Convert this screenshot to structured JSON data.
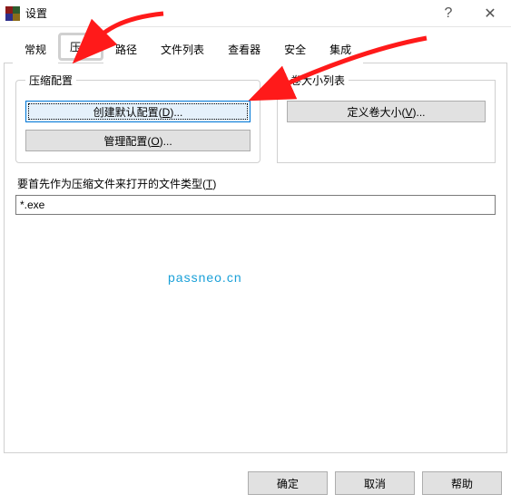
{
  "window": {
    "title": "设置"
  },
  "tabs": {
    "general": "常规",
    "compress": "压缩",
    "path": "路径",
    "filelist": "文件列表",
    "viewer": "查看器",
    "security": "安全",
    "integration": "集成"
  },
  "groups": {
    "compress_profile": {
      "legend": "压缩配置",
      "create_default_pre": "创建默认配置(",
      "create_default_key": "D",
      "create_default_post": ")...",
      "manage_pre": "管理配置(",
      "manage_key": "O",
      "manage_post": ")..."
    },
    "volume_list": {
      "legend": "卷大小列表",
      "define_pre": "定义卷大小(",
      "define_key": "V",
      "define_post": ")..."
    }
  },
  "filetype": {
    "label_pre": "要首先作为压缩文件来打开的文件类型(",
    "label_key": "T",
    "label_post": ")",
    "value": "*.exe"
  },
  "watermark": "passneo.cn",
  "footer": {
    "ok": "确定",
    "cancel": "取消",
    "help": "帮助"
  }
}
